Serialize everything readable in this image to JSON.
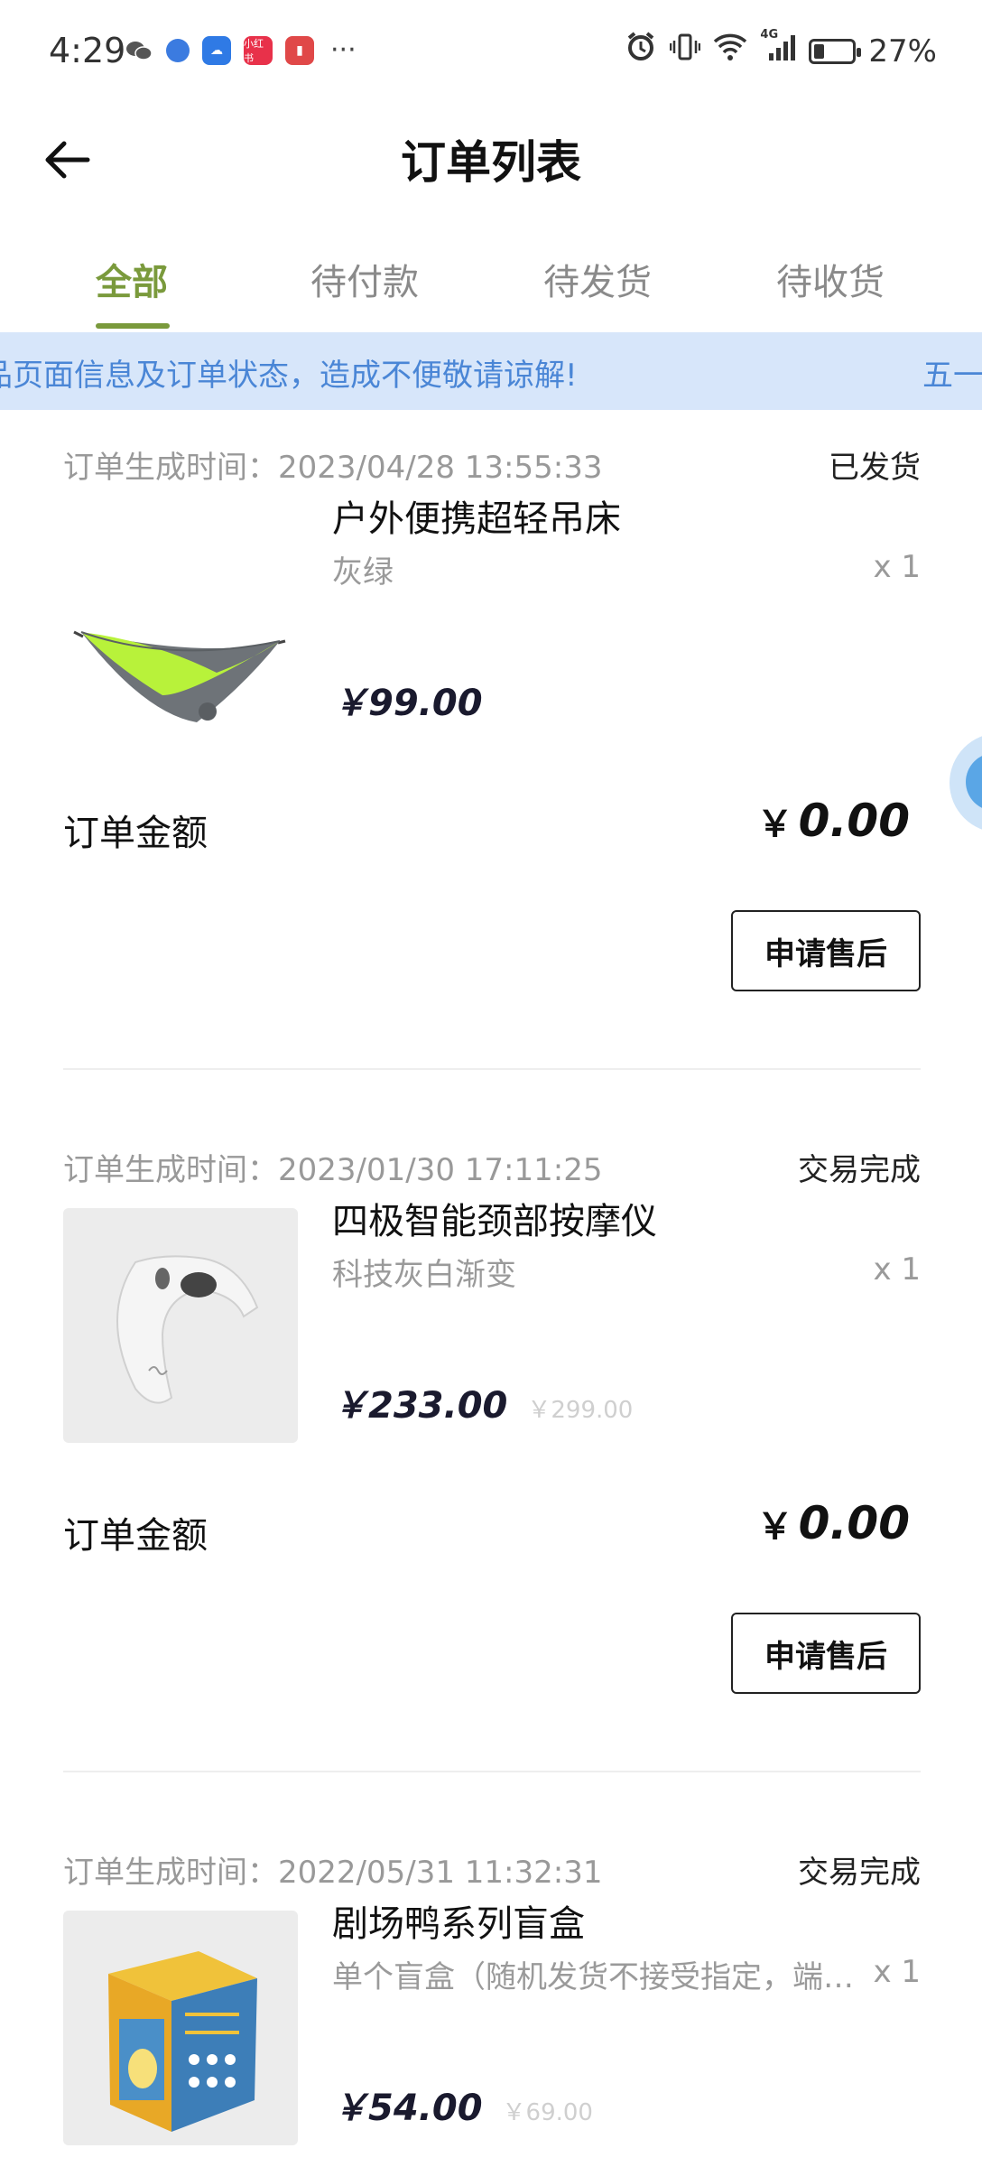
{
  "status_bar": {
    "time": "4:29",
    "app_icons": [
      "wechat-icon",
      "browser-icon",
      "weather-icon",
      "xiaohongshu-icon",
      "reader-icon"
    ],
    "more": "···",
    "network": "4G",
    "battery": "27%",
    "battery_level": 0.27
  },
  "header": {
    "title": "订单列表"
  },
  "tabs": [
    {
      "label": "全部",
      "active": true
    },
    {
      "label": "待付款",
      "active": false
    },
    {
      "label": "待发货",
      "active": false
    },
    {
      "label": "待收货",
      "active": false
    }
  ],
  "notice": {
    "text": "品页面信息及订单状态，造成不便敬请谅解!",
    "text_next": "五一"
  },
  "orders": [
    {
      "time_label": "订单生成时间：2023/04/28 13:55:33",
      "status": "已发货",
      "product_name": "户外便携超轻吊床",
      "spec": "灰绿",
      "qty": "x 1",
      "price": "￥99.00",
      "original_price": "",
      "amount_label": "订单金额",
      "amount_currency": "￥",
      "amount": "0.00",
      "button": "申请售后"
    },
    {
      "time_label": "订单生成时间：2023/01/30 17:11:25",
      "status": "交易完成",
      "product_name": "四极智能颈部按摩仪",
      "spec": "科技灰白渐变",
      "qty": "x 1",
      "price": "￥233.00",
      "original_price": "￥299.00",
      "amount_label": "订单金额",
      "amount_currency": "￥",
      "amount": "0.00",
      "button": "申请售后"
    },
    {
      "time_label": "订单生成时间：2022/05/31 11:32:31",
      "status": "交易完成",
      "product_name": "剧场鸭系列盲盒",
      "spec": "单个盲盒（随机发货不接受指定，端…",
      "qty": "x 1",
      "price": "￥54.00",
      "original_price": "￥69.00"
    }
  ],
  "colors": {
    "accent": "#7a9a3c",
    "notice_bg": "#d7e6fa",
    "notice_text": "#4a86d6"
  }
}
